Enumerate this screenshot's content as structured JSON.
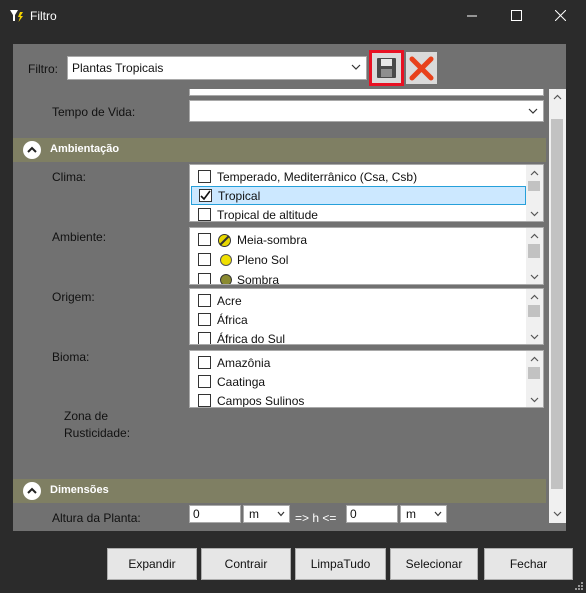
{
  "window": {
    "title": "Filtro"
  },
  "filter": {
    "label": "Filtro:",
    "value": "Plantas Tropicais"
  },
  "fields": {
    "tempo_de_vida": "Tempo de Vida:",
    "clima": "Clima:",
    "ambiente": "Ambiente:",
    "origem": "Origem:",
    "bioma": "Bioma:",
    "zona_line1": "Zona de",
    "zona_line2": "Rusticidade:",
    "altura": "Altura da Planta:"
  },
  "sections": {
    "ambientacao": "Ambientação",
    "dimensoes": "Dimensões"
  },
  "clima_items": [
    {
      "label": "Temperado, Mediterrânico (Csa, Csb)",
      "checked": false
    },
    {
      "label": "Tropical",
      "checked": true
    },
    {
      "label": "Tropical de altitude",
      "checked": false
    }
  ],
  "ambiente_items": [
    {
      "label": "Meia-sombra",
      "icon": "half-sun-icon",
      "checked": false
    },
    {
      "label": "Pleno Sol",
      "icon": "sun-icon",
      "checked": false
    },
    {
      "label": "Sombra",
      "icon": "shade-icon",
      "checked": false
    }
  ],
  "origem_items": [
    {
      "label": "Acre",
      "checked": false
    },
    {
      "label": "África",
      "checked": false
    },
    {
      "label": "África do Sul",
      "checked": false
    }
  ],
  "bioma_items": [
    {
      "label": "Amazônia",
      "checked": false
    },
    {
      "label": "Caatinga",
      "checked": false
    },
    {
      "label": "Campos Sulinos",
      "checked": false
    }
  ],
  "altura": {
    "value1": "0",
    "unit1": "m",
    "op": "=> h <=",
    "value2": "0",
    "unit2": "m"
  },
  "buttons": {
    "expandir": "Expandir",
    "contrair": "Contrair",
    "limpatudo": "LimpaTudo",
    "selecionar": "Selecionar",
    "fechar": "Fechar"
  },
  "colors": {
    "section_header": "#7f7f63",
    "panel": "#717171",
    "highlight": "#e81123"
  }
}
